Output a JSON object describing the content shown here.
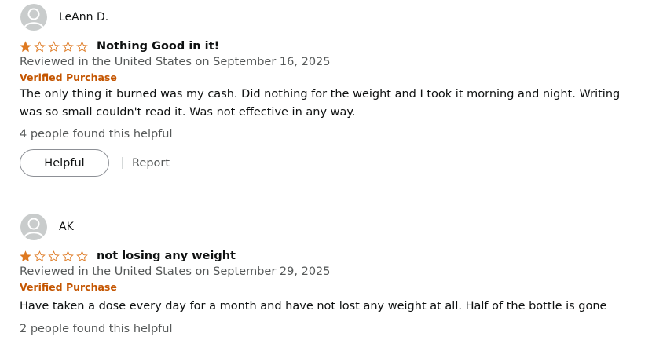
{
  "reviews": [
    {
      "author": "LeAnn D.",
      "rating": 1,
      "title": "Nothing Good in it!",
      "meta": "Reviewed in the United States on September 16, 2025",
      "verified": "Verified Purchase",
      "body": "The only thing it burned was my cash. Did nothing for the weight and I took it morning and night. Writing was so small couldn't read it. Was not effective in any way.",
      "helpful_count": "4 people found this helpful",
      "helpful_label": "Helpful",
      "report_label": "Report"
    },
    {
      "author": "AK",
      "rating": 1,
      "title": "not losing any weight",
      "meta": "Reviewed in the United States on September 29, 2025",
      "verified": "Verified Purchase",
      "body": "Have taken a dose every day for a month and have not lost any weight at all. Half of the bottle is gone",
      "helpful_count": "2 people found this helpful"
    }
  ],
  "colors": {
    "star": "#de7921",
    "verified": "#c45500",
    "meta": "#565959"
  },
  "icons": {
    "avatar": "default-user-avatar-icon",
    "star_filled": "star-filled-icon",
    "star_empty": "star-empty-icon"
  }
}
